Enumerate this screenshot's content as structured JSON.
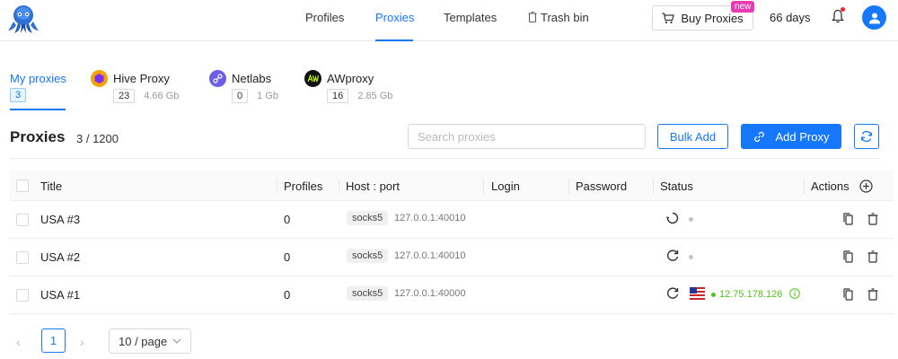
{
  "nav": {
    "items": [
      "Profiles",
      "Proxies",
      "Templates",
      "Trash bin"
    ],
    "active": "Proxies"
  },
  "header": {
    "buy_proxies": "Buy Proxies",
    "new_badge": "new",
    "days": "66 days"
  },
  "providers": [
    {
      "name": "My proxies",
      "count": "3",
      "size": ""
    },
    {
      "name": "Hive Proxy",
      "count": "23",
      "size": "4.66 Gb",
      "icon": "hive-icon",
      "color": "#7b2ff7"
    },
    {
      "name": "Netlabs",
      "count": "0",
      "size": "1 Gb",
      "icon": "netlabs-icon",
      "color": "#6c5ce7"
    },
    {
      "name": "AWproxy",
      "count": "16",
      "size": "2.85 Gb",
      "icon": "awproxy-icon",
      "color": "#111111"
    }
  ],
  "section": {
    "title": "Proxies",
    "count": "3 / 1200",
    "search_placeholder": "Search proxies",
    "bulk_add": "Bulk Add",
    "add_proxy": "Add Proxy"
  },
  "table": {
    "headers": [
      "Title",
      "Profiles",
      "Host : port",
      "Login",
      "Password",
      "Status",
      "Actions"
    ],
    "rows": [
      {
        "title": "USA #3",
        "profiles": "0",
        "protocol": "socks5",
        "host": "127.0.0.1:40010",
        "status": "checking",
        "ip": ""
      },
      {
        "title": "USA #2",
        "profiles": "0",
        "protocol": "socks5",
        "host": "127.0.0.1:40010",
        "status": "unchecked",
        "ip": ""
      },
      {
        "title": "USA #1",
        "profiles": "0",
        "protocol": "socks5",
        "host": "127.0.0.1:40000",
        "status": "online",
        "ip": "12.75.178.126",
        "flag": "us-flag-icon"
      }
    ]
  },
  "pagination": {
    "current": "1",
    "page_size": "10 / page"
  },
  "colors": {
    "accent": "#1677ff",
    "success": "#52c41a",
    "badge": "#e83ab3"
  }
}
